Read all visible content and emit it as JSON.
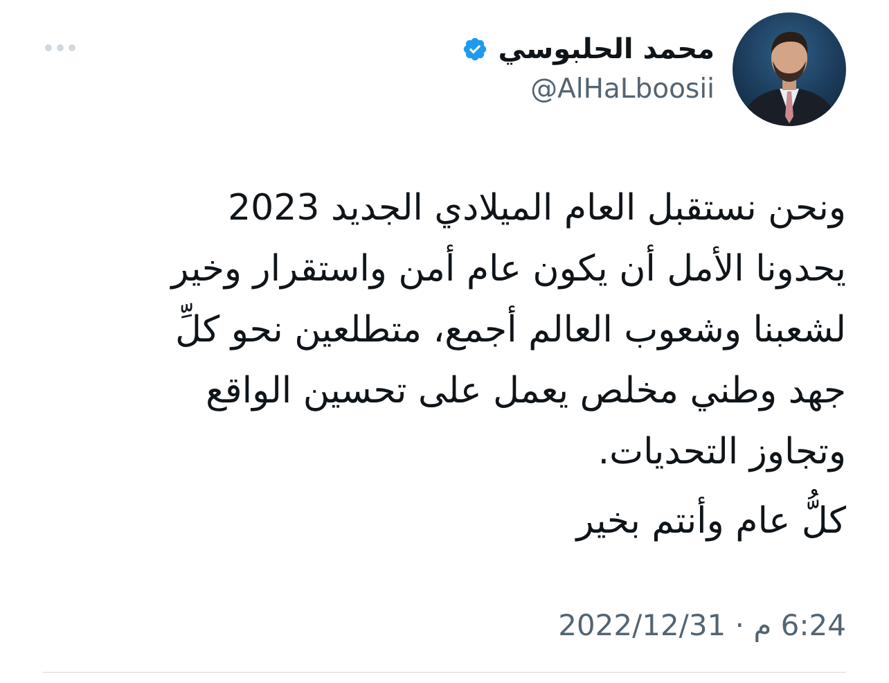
{
  "user": {
    "display_name": "محمد الحلبوسي",
    "handle": "@AlHaLboosii",
    "verified": true
  },
  "tweet": {
    "lines": [
      "ونحن نستقبل العام الميلادي الجديد 2023",
      "يحدونا الأمل أن يكون عام أمن واستقرار وخير",
      "لشعبنا وشعوب العالم أجمع، متطلعين نحو كلِّ",
      "جهد وطني مخلص يعمل على تحسين الواقع",
      "وتجاوز التحديات."
    ],
    "closing": "كلُّ عام وأنتم بخير"
  },
  "meta": {
    "timestamp": "6:24 م · 2022/12/31"
  },
  "icons": {
    "verified": "verified-badge-icon",
    "more": "more-options-icon"
  },
  "colors": {
    "verified_blue": "#1d9bf0",
    "secondary_text": "#536471",
    "divider": "#cfd9de"
  }
}
